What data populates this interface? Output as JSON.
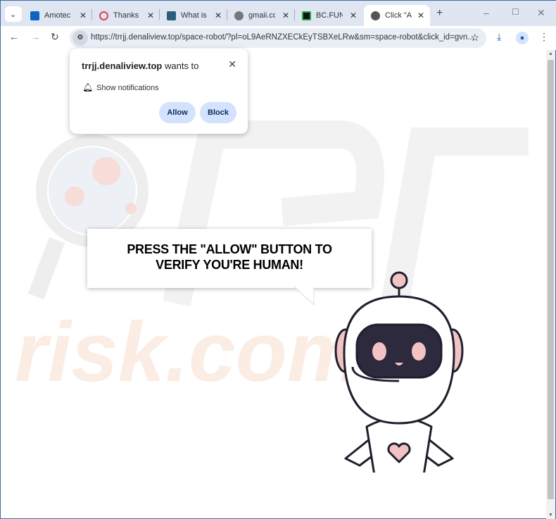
{
  "tabs": [
    {
      "label": "Amotec li",
      "color": "#0a66c2"
    },
    {
      "label": "Thanks fo",
      "color": "#e0405a"
    },
    {
      "label": "What is y",
      "color": "#2b5e7e"
    },
    {
      "label": "gmaii.con",
      "color": "#666"
    },
    {
      "label": "BC.FUN: C",
      "color": "#1fa84a"
    },
    {
      "label": "Click \"Allo",
      "color": "#444"
    }
  ],
  "address": {
    "url": "https://trrjj.denaliview.top/space-robot/?pl=oL9AeRNZXECkEyTSBXeLRw&sm=space-robot&click_id=gvn..."
  },
  "popup": {
    "site": "trrjj.denaliview.top",
    "wants": " wants to",
    "permission": "Show notifications",
    "allow": "Allow",
    "block": "Block"
  },
  "page": {
    "message": "PRESS THE \"ALLOW\" BUTTON TO VERIFY YOU'RE HUMAN!",
    "watermark": "risk.com"
  }
}
